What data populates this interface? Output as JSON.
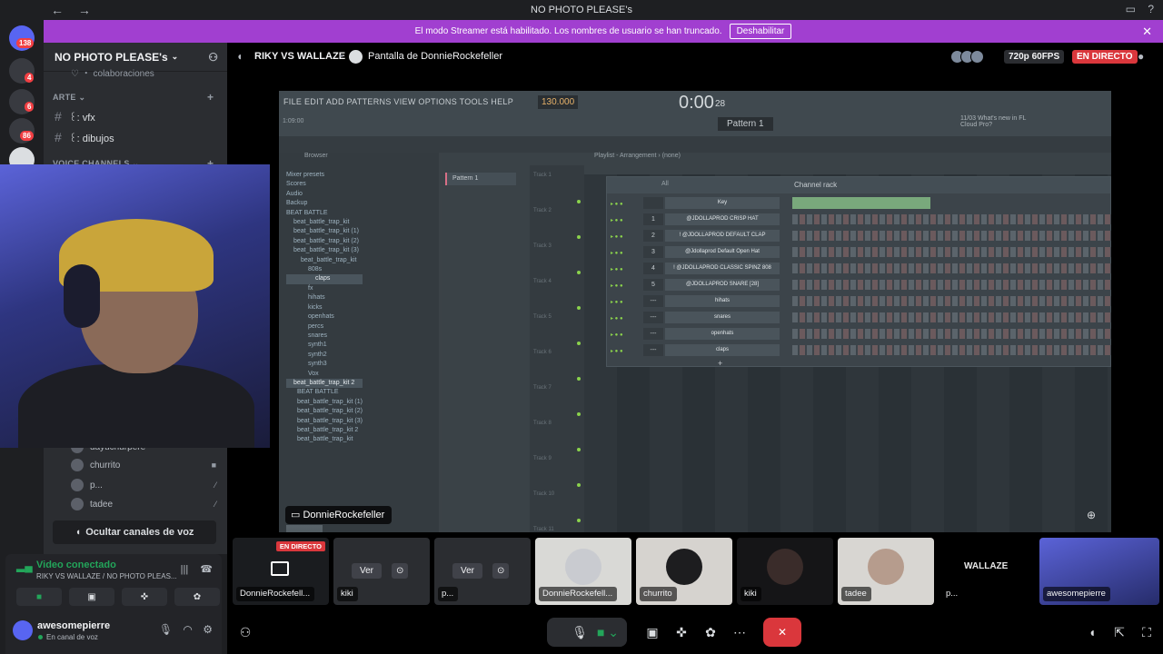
{
  "window": {
    "title": "NO PHOTO PLEASE's",
    "back_icon": "←",
    "forward_icon": "→"
  },
  "banner": {
    "text": "El modo Streamer está habilitado. Los nombres de usuario se han truncado.",
    "button": "Deshabilitar",
    "close": "✕"
  },
  "servers": {
    "badges": [
      "138",
      "4",
      "6",
      "86"
    ]
  },
  "guild": {
    "name": "NO PHOTO PLEASE's",
    "partial_channel": "♡ ・ colaboraciones"
  },
  "categories": {
    "arte": "ARTE",
    "voice": "VOICE CHANNELS"
  },
  "channels": [
    {
      "name": "꒰: vfx"
    },
    {
      "name": "꒰: dibujos"
    }
  ],
  "voice_users": [
    {
      "name": "dayuchurpere"
    },
    {
      "name": "churrito"
    },
    {
      "name": "p..."
    },
    {
      "name": "tadee"
    }
  ],
  "hide_voice_label": "Ocultar canales de voz",
  "voice_panel": {
    "status": "Video conectado",
    "location": "RIKY VS WALLAZE / NO PHOTO PLEAS..."
  },
  "user": {
    "name": "awesomepierre",
    "status": "En canal de voz"
  },
  "stage": {
    "channel": "RIKY VS WALLAZE",
    "screen_title": "Pantalla de DonnieRockefeller",
    "quality": "720p 60FPS",
    "live": "EN DIRECTO",
    "stream_owner": "DonnieRockefeller"
  },
  "fl": {
    "menu": "FILE  EDIT  ADD  PATTERNS  VIEW  OPTIONS  TOOLS  HELP",
    "tempo": "130.000",
    "time": "0:00",
    "time_small": "28",
    "pattern": "Pattern 1",
    "news": "11/03  What's new in FL Cloud Pro?",
    "position": "1:09:00",
    "browser_title": "Browser",
    "playlist_title": "Playlist - Arrangement › (none)",
    "pattern_item": "Pattern 1",
    "channel_rack_title": "Channel rack",
    "channel_rack_filter": "All",
    "tree": [
      "Mixer presets",
      "Scores",
      "Audio",
      "Backup",
      "BEAT BATTLE",
      "beat_battle_trap_kit",
      "beat_battle_trap_kit (1)",
      "beat_battle_trap_kit (2)",
      "beat_battle_trap_kit (3)",
      "beat_battle_trap_kit",
      "808s",
      "claps",
      "fx",
      "hihats",
      "kicks",
      "openhats",
      "percs",
      "snares",
      "synth1",
      "synth2",
      "synth3",
      "Vox",
      "beat_battle_trap_kit 2",
      "BEAT BATTLE",
      "beat_battle_trap_kit (1)",
      "beat_battle_trap_kit (2)",
      "beat_battle_trap_kit (3)",
      "beat_battle_trap_kit 2",
      "beat_battle_trap_kit"
    ],
    "tracks": [
      "Track 1",
      "Track 2",
      "Track 3",
      "Track 4",
      "Track 5",
      "Track 6",
      "Track 7",
      "Track 8",
      "Track 9",
      "Track 10",
      "Track 11"
    ],
    "channels": [
      {
        "num": "",
        "name": "Key"
      },
      {
        "num": "1",
        "name": "@JDOLLAPROD CRISP HAT"
      },
      {
        "num": "2",
        "name": "! @JDOLLAPROD DEFAULT CLAP"
      },
      {
        "num": "3",
        "name": "@Jdollaprod Default Open Hat"
      },
      {
        "num": "4",
        "name": "! @JDOLLAPROD CLASSIC SPINZ 808"
      },
      {
        "num": "5",
        "name": "@JDOLLAPROD SNARE [28]"
      },
      {
        "num": "---",
        "name": "hihats"
      },
      {
        "num": "---",
        "name": "snares"
      },
      {
        "num": "---",
        "name": "openhats"
      },
      {
        "num": "---",
        "name": "claps"
      }
    ]
  },
  "tiles": [
    {
      "label": "DonnieRockefell...",
      "live": "EN DIRECTO"
    },
    {
      "label": "kiki",
      "button": "Ver"
    },
    {
      "label": "p...",
      "button": "Ver"
    },
    {
      "label": "DonnieRockefell..."
    },
    {
      "label": "churrito"
    },
    {
      "label": "kiki"
    },
    {
      "label": "tadee"
    },
    {
      "label": "p...",
      "wordmark": "WALLAZE"
    },
    {
      "label": "awesomepierre"
    }
  ],
  "colors": {
    "banner": "#a13fd0",
    "live": "#da373c",
    "connected": "#23a55a"
  }
}
